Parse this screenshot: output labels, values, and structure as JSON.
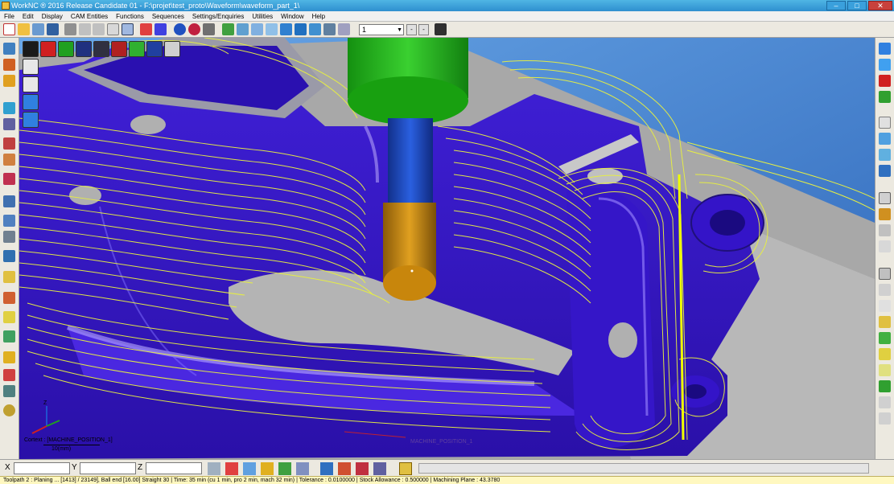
{
  "window": {
    "title": "WorkNC ® 2016 Release Candidate 01 - F:\\projet\\test_proto\\Waveform\\waveform_part_1\\",
    "minimize": "–",
    "maximize": "□",
    "close": "✕"
  },
  "menu": [
    "File",
    "Edit",
    "Display",
    "CAM Entities",
    "Functions",
    "Sequences",
    "Settings/Enquiries",
    "Utilities",
    "Window",
    "Help"
  ],
  "toolbar": {
    "combo_value": "1",
    "combo_arrow": "▼",
    "spin_minus": "-",
    "spin_plus": "-"
  },
  "viewport": {
    "coord_system_label": "Cortext : [MACHINE_POSITION_1]",
    "scale_label": "10(mm)",
    "machine_label": "MACHINE_POSITION_1"
  },
  "coordbar": {
    "x_label": "X",
    "y_label": "Y",
    "z_label": "Z"
  },
  "status": {
    "text": "Toolpath 2 : Planing ... [1413] / 23149], Ball end [16.00] Straight 30 | Time: 35 min (cu 1 min, pro 2 min, mach 32 min) | Tolerance : 0.0100000 | Stock Allowance : 0.500000 | Machining Plane : 43.3780"
  },
  "colors": {
    "part": "#3a1ad0",
    "part_dark": "#1e0a8a",
    "toolpath": "#e8f040",
    "holder": "#22b820",
    "shank": "#1e4ac8",
    "tool_tip": "#d08c10",
    "background": "#5fa0e0",
    "base_grey": "#b0b0b0"
  }
}
